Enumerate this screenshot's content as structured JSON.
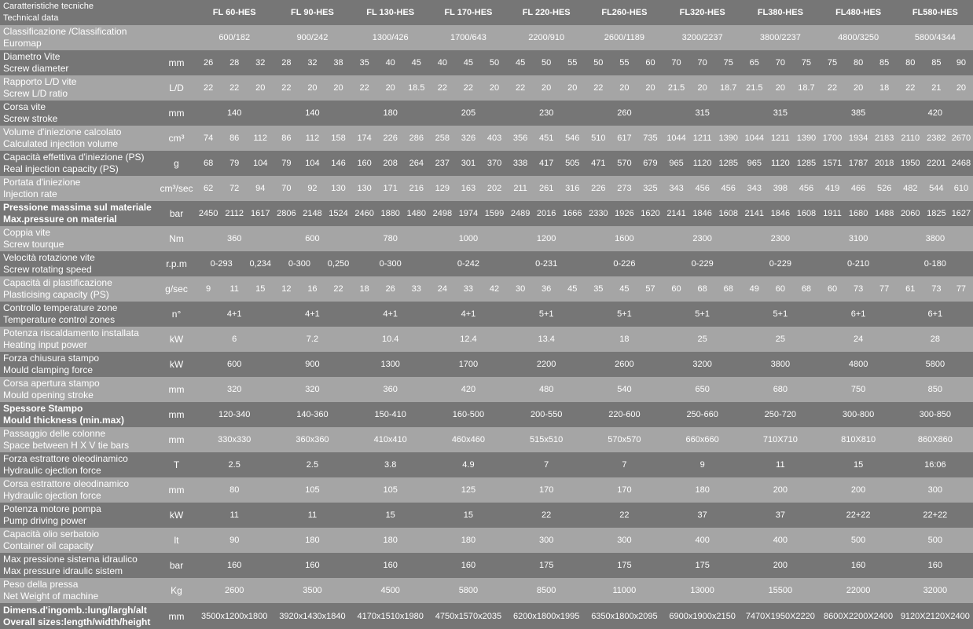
{
  "header": {
    "label": [
      "Caratteristiche tecniche",
      "Technical data"
    ],
    "models": [
      "FL 60-HES",
      "FL 90-HES",
      "FL 130-HES",
      "FL 170-HES",
      "FL 220-HES",
      "FL260-HES",
      "FL320-HES",
      "FL380-HES",
      "FL480-HES",
      "FL580-HES"
    ]
  },
  "rows": [
    {
      "label": [
        "Classificazione /Classification",
        "Euromap"
      ],
      "unit": "",
      "values": [
        "600/182",
        "900/242",
        "1300/426",
        "1700/643",
        "2200/910",
        "2600/1189",
        "3200/2237",
        "3800/2237",
        "4800/3250",
        "5800/4344"
      ]
    },
    {
      "label": [
        "Diametro Vite",
        "Screw diameter"
      ],
      "unit": "mm",
      "values": [
        "26",
        "28",
        "32",
        "28",
        "32",
        "38",
        "35",
        "40",
        "45",
        "40",
        "45",
        "50",
        "45",
        "50",
        "55",
        "50",
        "55",
        "60",
        "70",
        "70",
        "75",
        "65",
        "70",
        "75",
        "75",
        "80",
        "85",
        "80",
        "85",
        "90"
      ]
    },
    {
      "label": [
        "Rapporto L/D  vite",
        "Screw L/D ratio"
      ],
      "unit": "L/D",
      "values": [
        "22",
        "22",
        "20",
        "22",
        "20",
        "20",
        "22",
        "20",
        "18.5",
        "22",
        "22",
        "20",
        "22",
        "20",
        "20",
        "22",
        "20",
        "20",
        "21.5",
        "20",
        "18.7",
        "21.5",
        "20",
        "18.7",
        "22",
        "20",
        "18",
        "22",
        "21",
        "20"
      ]
    },
    {
      "label": [
        "Corsa vite",
        "Screw stroke"
      ],
      "unit": "mm",
      "values": [
        "140",
        "140",
        "180",
        "205",
        "230",
        "260",
        "315",
        "315",
        "385",
        "420"
      ]
    },
    {
      "label": [
        "Volume d'iniezione calcolato",
        "Calculated injection volume"
      ],
      "unit": "cm³",
      "values": [
        "74",
        "86",
        "112",
        "86",
        "112",
        "158",
        "174",
        "226",
        "286",
        "258",
        "326",
        "403",
        "356",
        "451",
        "546",
        "510",
        "617",
        "735",
        "1044",
        "1211",
        "1390",
        "1044",
        "1211",
        "1390",
        "1700",
        "1934",
        "2183",
        "2110",
        "2382",
        "2670"
      ]
    },
    {
      "label": [
        "Capacità effettiva d'iniezione (PS)",
        "Real injection capacity (PS)"
      ],
      "unit": "g",
      "values": [
        "68",
        "79",
        "104",
        "79",
        "104",
        "146",
        "160",
        "208",
        "264",
        "237",
        "301",
        "370",
        "338",
        "417",
        "505",
        "471",
        "570",
        "679",
        "965",
        "1120",
        "1285",
        "965",
        "1120",
        "1285",
        "1571",
        "1787",
        "2018",
        "1950",
        "2201",
        "2468"
      ]
    },
    {
      "label": [
        "Portata d'iniezione",
        "Injection rate"
      ],
      "unit": "cm³/sec",
      "values": [
        "62",
        "72",
        "94",
        "70",
        "92",
        "130",
        "130",
        "171",
        "216",
        "129",
        "163",
        "202",
        "211",
        "261",
        "316",
        "226",
        "273",
        "325",
        "343",
        "456",
        "456",
        "343",
        "398",
        "456",
        "419",
        "466",
        "526",
        "482",
        "544",
        "610"
      ]
    },
    {
      "label": [
        "Pressione massima sul materiale",
        "Max.pressure on material"
      ],
      "unit": "bar",
      "values": [
        "2450",
        "2112",
        "1617",
        "2806",
        "2148",
        "1524",
        "2460",
        "1880",
        "1480",
        "2498",
        "1974",
        "1599",
        "2489",
        "2016",
        "1666",
        "2330",
        "1926",
        "1620",
        "2141",
        "1846",
        "1608",
        "2141",
        "1846",
        "1608",
        "1911",
        "1680",
        "1488",
        "2060",
        "1825",
        "1627"
      ]
    },
    {
      "label": [
        "Coppia vite",
        "Screw tourque"
      ],
      "unit": "Nm",
      "values": [
        "360",
        "600",
        "780",
        "1000",
        "1200",
        "1600",
        "2300",
        "2300",
        "3100",
        "3800"
      ]
    },
    {
      "label": [
        "Velocità rotazione vite",
        "Screw rotating speed"
      ],
      "unit": "r.p.m",
      "values": [
        "0-293",
        "0,234",
        "0-300",
        "0,250",
        "0-300",
        "0-242",
        "0-231",
        "0-226",
        "0-229",
        "0-229",
        "0-210",
        "0-180"
      ]
    },
    {
      "label": [
        "Capacità di plastificazione",
        "Plasticising capacity (PS)"
      ],
      "unit": "g/sec",
      "values": [
        "9",
        "11",
        "15",
        "12",
        "16",
        "22",
        "18",
        "26",
        "33",
        "24",
        "33",
        "42",
        "30",
        "36",
        "45",
        "35",
        "45",
        "57",
        "60",
        "68",
        "68",
        "49",
        "60",
        "68",
        "60",
        "73",
        "77",
        "61",
        "73",
        "77"
      ]
    },
    {
      "label": [
        "Controllo temperature zone",
        "Temperature control zones"
      ],
      "unit": "n°",
      "values": [
        "4+1",
        "4+1",
        "4+1",
        "4+1",
        "5+1",
        "5+1",
        "5+1",
        "5+1",
        "6+1",
        "6+1"
      ]
    },
    {
      "label": [
        "Potenza riscaldamento installata",
        "Heating input power"
      ],
      "unit": "kW",
      "values": [
        "6",
        "7.2",
        "10.4",
        "12.4",
        "13.4",
        "18",
        "25",
        "25",
        "24",
        "28"
      ]
    },
    {
      "label": [
        "Forza chiusura stampo",
        "Mould clamping force"
      ],
      "unit": "kW",
      "values": [
        "600",
        "900",
        "1300",
        "1700",
        "2200",
        "2600",
        "3200",
        "3800",
        "4800",
        "5800"
      ]
    },
    {
      "label": [
        "Corsa apertura stampo",
        "Mould opening stroke"
      ],
      "unit": "mm",
      "values": [
        "320",
        "320",
        "360",
        "420",
        "480",
        "540",
        "650",
        "680",
        "750",
        "850"
      ]
    },
    {
      "label": [
        "Spessore Stampo",
        "Mould thickness (min.max)"
      ],
      "unit": "mm",
      "values": [
        "120-340",
        "140-360",
        "150-410",
        "160-500",
        "200-550",
        "220-600",
        "250-660",
        "250-720",
        "300-800",
        "300-850"
      ]
    },
    {
      "label": [
        "Passaggio delle colonne",
        "Space between H X V tie bars"
      ],
      "unit": "mm",
      "values": [
        "330x330",
        "360x360",
        "410x410",
        "460x460",
        "515x510",
        "570x570",
        "660x660",
        "710X710",
        "810X810",
        "860X860"
      ]
    },
    {
      "label": [
        "Forza estrattore oleodinamico",
        "Hydraulic ojection force"
      ],
      "unit": "T",
      "values": [
        "2.5",
        "2.5",
        "3.8",
        "4.9",
        "7",
        "7",
        "9",
        "11",
        "15",
        "16:06"
      ]
    },
    {
      "label": [
        "Corsa estrattore oleodinamico",
        "Hydraulic ojection force"
      ],
      "unit": "mm",
      "values": [
        "80",
        "105",
        "105",
        "125",
        "170",
        "170",
        "180",
        "200",
        "200",
        "300"
      ]
    },
    {
      "label": [
        "Potenza motore pompa",
        "Pump driving power"
      ],
      "unit": "kW",
      "values": [
        "11",
        "11",
        "15",
        "15",
        "22",
        "22",
        "37",
        "37",
        "22+22",
        "22+22"
      ]
    },
    {
      "label": [
        "Capacità olio serbatoio",
        "Container oil capacity"
      ],
      "unit": "lt",
      "values": [
        "90",
        "180",
        "180",
        "180",
        "300",
        "300",
        "400",
        "400",
        "500",
        "500"
      ]
    },
    {
      "label": [
        "Max pressione sistema idraulico",
        "Max pressure idraulic sistem"
      ],
      "unit": "bar",
      "values": [
        "160",
        "160",
        "160",
        "160",
        "175",
        "175",
        "175",
        "200",
        "160",
        "160"
      ]
    },
    {
      "label": [
        "Peso della pressa",
        "Net Weight of machine"
      ],
      "unit": "Kg",
      "values": [
        "2600",
        "3500",
        "4500",
        "5800",
        "8500",
        "11000",
        "13000",
        "15500",
        "22000",
        "32000"
      ]
    },
    {
      "label": [
        "Dimens.d'ingomb.:lung/largh/alt",
        "Overall sizes:length/width/height"
      ],
      "unit": "mm",
      "values": [
        "3500x1200x1800",
        "3920x1430x1840",
        "4170x1510x1980",
        "4750x1570x2035",
        "6200x1800x1995",
        "6350x1800x2095",
        "6900x1900x2150",
        "7470X1950X2220",
        "8600X2200X2400",
        "9120X2120X2400"
      ]
    }
  ]
}
